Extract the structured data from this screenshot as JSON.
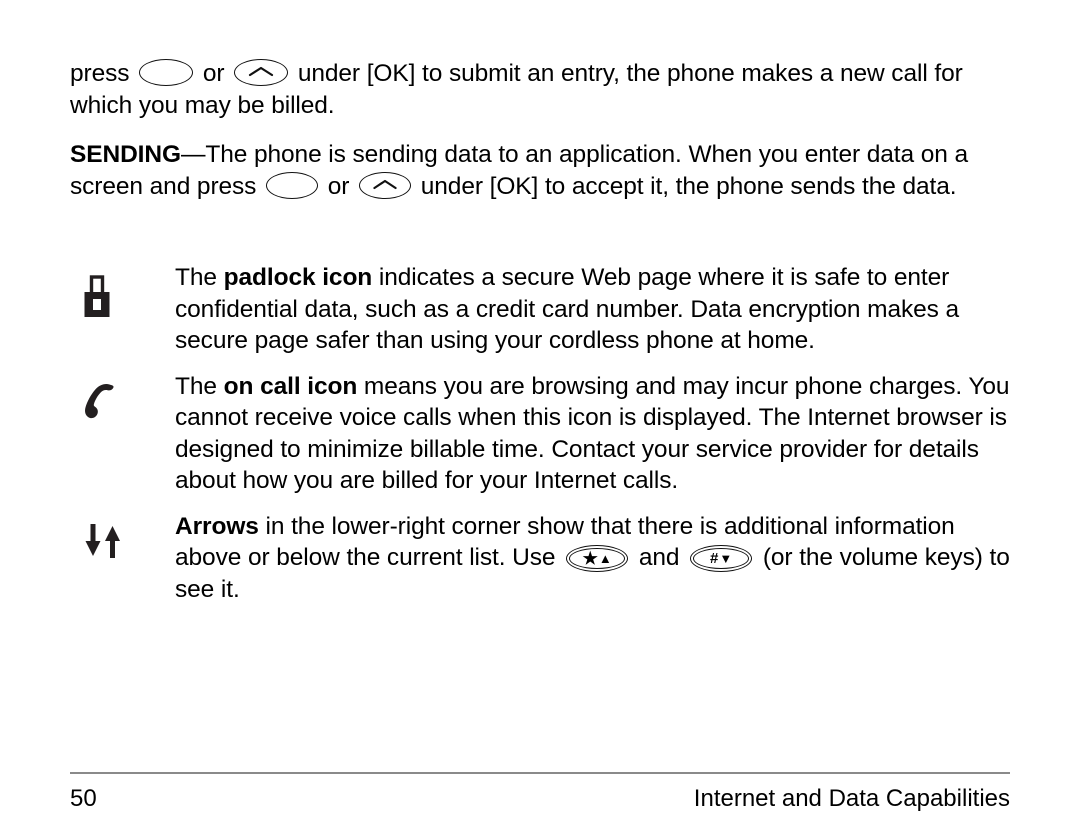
{
  "document": {
    "page_number": "50",
    "footer_title": "Internet and Data Capabilities"
  },
  "body": {
    "paragraph_continuation": {
      "before_key1": "press ",
      "between_keys": " or ",
      "after_key2": " under [OK] to submit an entry, the phone makes a new call for which you may be billed."
    },
    "sending_paragraph": {
      "term": "SENDING",
      "dash": "—",
      "text_before_keys": "The phone is sending data to an application. When you enter data on a screen and press ",
      "between_keys": " or ",
      "text_after_keys": " under [OK] to accept it, the phone sends the data."
    }
  },
  "definitions": [
    {
      "icon": "padlock-icon",
      "term": "padlock icon",
      "text_before_term": "The ",
      "text_after_term": " indicates a secure Web page where it is safe to enter confidential data, such as a credit card number. Data encryption makes a secure page safer than using your cordless phone at home."
    },
    {
      "icon": "on-call-phone-icon",
      "term": "on call icon",
      "text_before_term": "The ",
      "text_after_term": " means you are browsing and may incur phone charges. You cannot receive voice calls when this icon is displayed. The Internet browser is designed to minimize billable time. Contact your service provider for details about how you are billed for your Internet calls."
    },
    {
      "icon": "up-down-arrows-icon",
      "term": "Arrows",
      "text_before_term": "",
      "text_after_term": " in the lower-right corner show that there is additional information above or below the current list. Use ",
      "text_between_keys": " and ",
      "text_tail": " (or the volume keys) to see it."
    }
  ],
  "keys": {
    "blank_softkey": {
      "name": "blank-oval-softkey",
      "glyph": ""
    },
    "caret_softkey": {
      "name": "caret-oval-softkey",
      "glyph": "^"
    },
    "star_up_key": {
      "name": "star-up-keypad-key",
      "star": "★",
      "triangle": "▲"
    },
    "hash_down_key": {
      "name": "hash-down-keypad-key",
      "hash": "#",
      "triangle": "▼"
    }
  },
  "colors": {
    "text": "#000000",
    "icon_fill": "#231f20",
    "rule": "#8a8a8a",
    "background": "#ffffff"
  }
}
